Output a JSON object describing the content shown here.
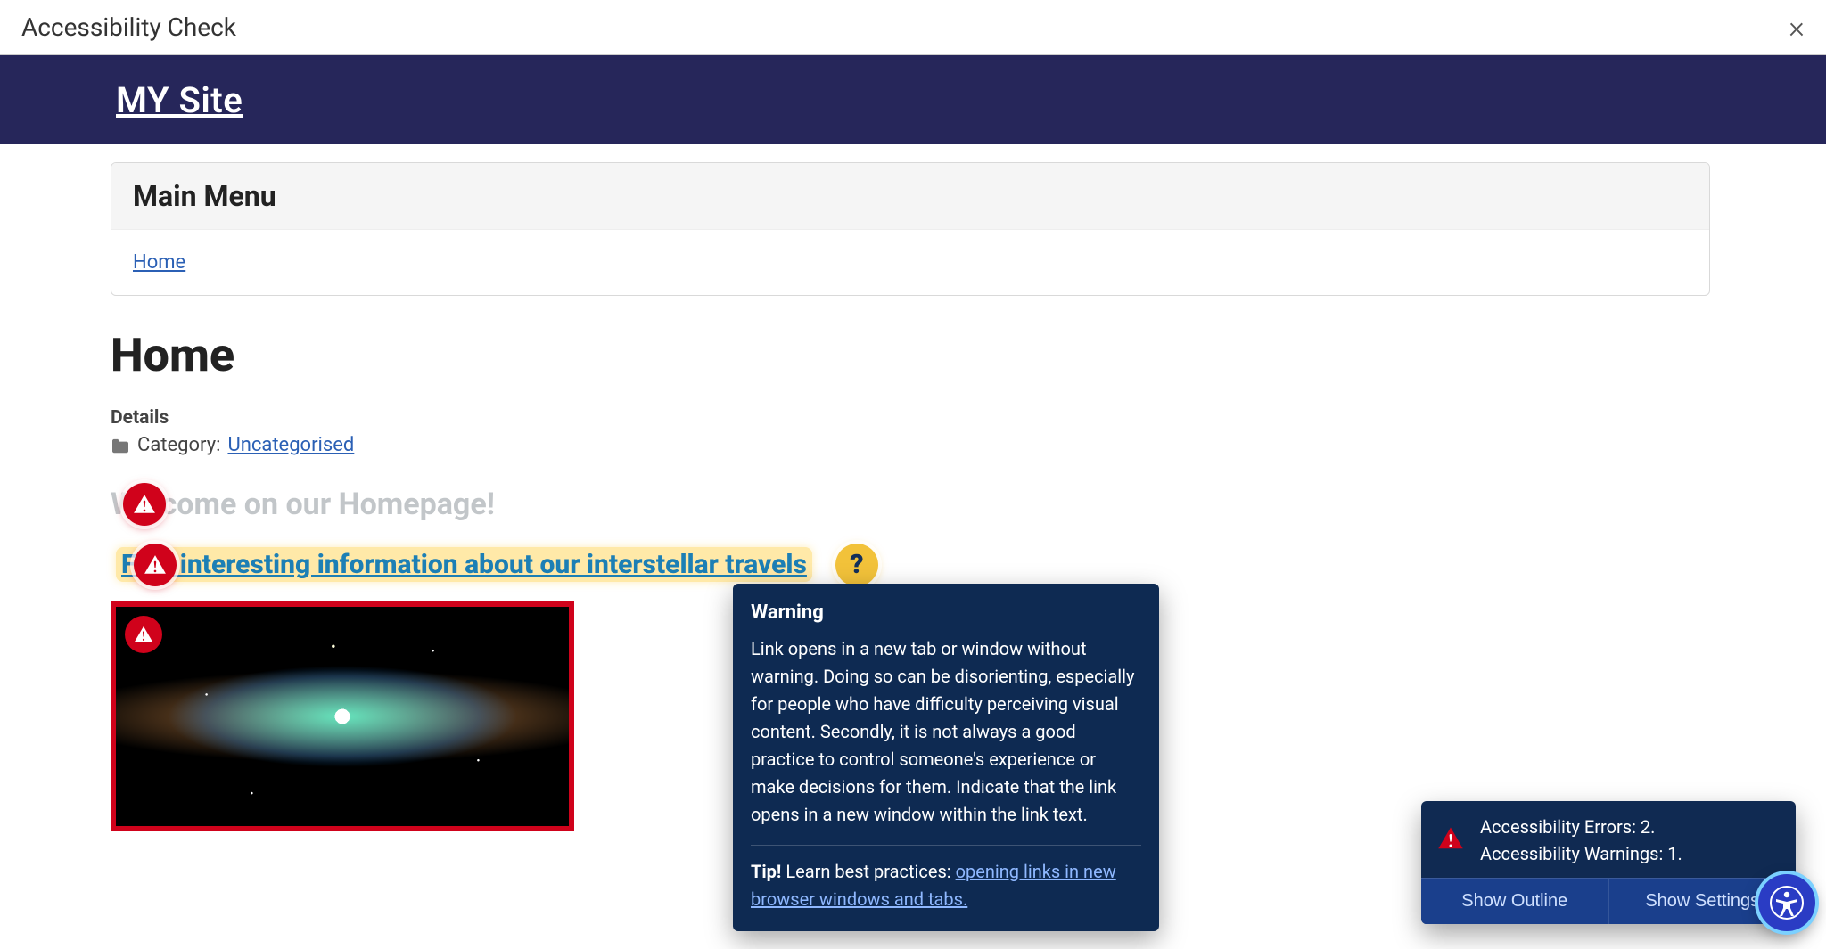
{
  "dialog": {
    "title": "Accessibility Check"
  },
  "site": {
    "title": "MY Site"
  },
  "menu": {
    "heading": "Main Menu",
    "home": "Home"
  },
  "article": {
    "title": "Home",
    "details_label": "Details",
    "category_label": "Category:",
    "category_value": "Uncategorised",
    "welcome_heading": "Welcome on our Homepage!",
    "link_text": "Find interesting information about our interstellar travels"
  },
  "tooltip": {
    "title": "Warning",
    "body": "Link opens in a new tab or window without warning. Doing so can be disorienting, especially for people who have difficulty perceiving visual content. Secondly, it is not always a good practice to control someone's experience or make decisions for them. Indicate that the link opens in a new window within the link text.",
    "tip_label": "Tip!",
    "tip_lead": " Learn best practices: ",
    "tip_link": "opening links in new browser windows and tabs."
  },
  "summary": {
    "errors_line": "Accessibility Errors: 2.",
    "warnings_line": "Accessibility Warnings: 1.",
    "outline_btn": "Show Outline",
    "settings_btn": "Show Settings"
  }
}
